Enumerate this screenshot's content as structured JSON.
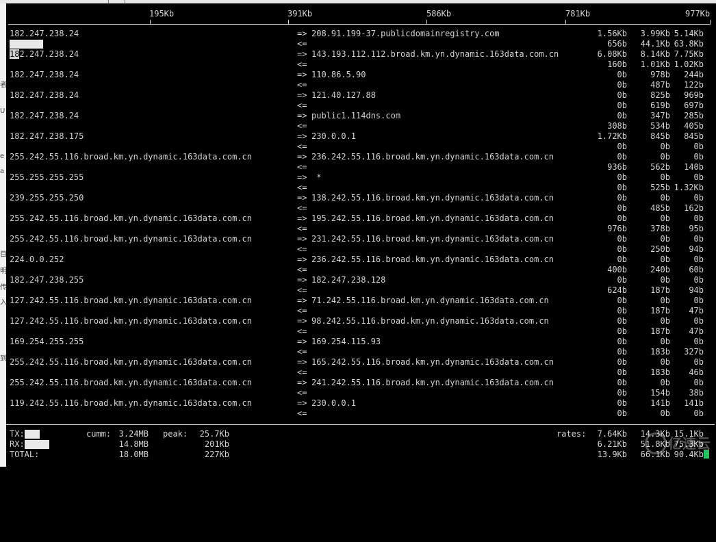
{
  "scale": {
    "labels": [
      "195Kb",
      "391Kb",
      "586Kb",
      "781Kb",
      "977Kb"
    ]
  },
  "connections": [
    {
      "src": "182.247.238.24",
      "dst": "208.91.199-37.publicdomainregistry.com",
      "out": [
        "1.56Kb",
        "3.99Kb",
        "5.14Kb"
      ],
      "in": [
        "656b",
        "44.1Kb",
        "63.8Kb"
      ]
    },
    {
      "src": "182.247.238.24",
      "dst": "143.193.112.112.broad.km.yn.dynamic.163data.com.cn",
      "out": [
        "6.08Kb",
        "8.14Kb",
        "7.75Kb"
      ],
      "in": [
        "160b",
        "1.01Kb",
        "1.02Kb"
      ]
    },
    {
      "src": "182.247.238.24",
      "dst": "110.86.5.90",
      "out": [
        "0b",
        "978b",
        "244b"
      ],
      "in": [
        "0b",
        "487b",
        "122b"
      ]
    },
    {
      "src": "182.247.238.24",
      "dst": "121.40.127.88",
      "out": [
        "0b",
        "825b",
        "969b"
      ],
      "in": [
        "0b",
        "619b",
        "697b"
      ]
    },
    {
      "src": "182.247.238.24",
      "dst": "public1.114dns.com",
      "out": [
        "0b",
        "347b",
        "285b"
      ],
      "in": [
        "308b",
        "534b",
        "405b"
      ]
    },
    {
      "src": "182.247.238.175",
      "dst": "230.0.0.1",
      "out": [
        "1.72Kb",
        "845b",
        "845b"
      ],
      "in": [
        "0b",
        "0b",
        "0b"
      ]
    },
    {
      "src": "255.242.55.116.broad.km.yn.dynamic.163data.com.cn",
      "dst": "236.242.55.116.broad.km.yn.dynamic.163data.com.cn",
      "out": [
        "0b",
        "0b",
        "0b"
      ],
      "in": [
        "936b",
        "562b",
        "140b"
      ]
    },
    {
      "src": "255.255.255.255",
      "dst": " *",
      "out": [
        "0b",
        "0b",
        "0b"
      ],
      "in": [
        "0b",
        "525b",
        "1.32Kb"
      ]
    },
    {
      "src": "239.255.255.250",
      "dst": "138.242.55.116.broad.km.yn.dynamic.163data.com.cn",
      "out": [
        "0b",
        "0b",
        "0b"
      ],
      "in": [
        "0b",
        "485b",
        "162b"
      ]
    },
    {
      "src": "255.242.55.116.broad.km.yn.dynamic.163data.com.cn",
      "dst": "195.242.55.116.broad.km.yn.dynamic.163data.com.cn",
      "out": [
        "0b",
        "0b",
        "0b"
      ],
      "in": [
        "976b",
        "378b",
        "95b"
      ]
    },
    {
      "src": "255.242.55.116.broad.km.yn.dynamic.163data.com.cn",
      "dst": "231.242.55.116.broad.km.yn.dynamic.163data.com.cn",
      "out": [
        "0b",
        "0b",
        "0b"
      ],
      "in": [
        "0b",
        "250b",
        "94b"
      ]
    },
    {
      "src": "224.0.0.252",
      "dst": "236.242.55.116.broad.km.yn.dynamic.163data.com.cn",
      "out": [
        "0b",
        "0b",
        "0b"
      ],
      "in": [
        "400b",
        "240b",
        "60b"
      ]
    },
    {
      "src": "182.247.238.255",
      "dst": "182.247.238.128",
      "out": [
        "0b",
        "0b",
        "0b"
      ],
      "in": [
        "624b",
        "187b",
        "94b"
      ]
    },
    {
      "src": "127.242.55.116.broad.km.yn.dynamic.163data.com.cn",
      "dst": "71.242.55.116.broad.km.yn.dynamic.163data.com.cn",
      "out": [
        "0b",
        "0b",
        "0b"
      ],
      "in": [
        "0b",
        "187b",
        "47b"
      ]
    },
    {
      "src": "127.242.55.116.broad.km.yn.dynamic.163data.com.cn",
      "dst": "98.242.55.116.broad.km.yn.dynamic.163data.com.cn",
      "out": [
        "0b",
        "0b",
        "0b"
      ],
      "in": [
        "0b",
        "187b",
        "47b"
      ]
    },
    {
      "src": "169.254.255.255",
      "dst": "169.254.115.93",
      "out": [
        "0b",
        "0b",
        "0b"
      ],
      "in": [
        "0b",
        "183b",
        "327b"
      ]
    },
    {
      "src": "255.242.55.116.broad.km.yn.dynamic.163data.com.cn",
      "dst": "165.242.55.116.broad.km.yn.dynamic.163data.com.cn",
      "out": [
        "0b",
        "0b",
        "0b"
      ],
      "in": [
        "0b",
        "183b",
        "46b"
      ]
    },
    {
      "src": "255.242.55.116.broad.km.yn.dynamic.163data.com.cn",
      "dst": "241.242.55.116.broad.km.yn.dynamic.163data.com.cn",
      "out": [
        "0b",
        "0b",
        "0b"
      ],
      "in": [
        "0b",
        "154b",
        "38b"
      ]
    },
    {
      "src": "119.242.55.116.broad.km.yn.dynamic.163data.com.cn",
      "dst": "230.0.0.1",
      "out": [
        "0b",
        "141b",
        "141b"
      ],
      "in": [
        "0b",
        "0b",
        "0b"
      ]
    }
  ],
  "arrows": {
    "out": "=>",
    "in": "<="
  },
  "footer": {
    "tx": {
      "label": "TX:",
      "cumm_label": "cumm:",
      "cumm": "3.24MB",
      "peak_label": "peak:",
      "peak": "25.7Kb",
      "rates_label": "rates:",
      "rates": [
        "7.64Kb",
        "14.3Kb",
        "15.1Kb"
      ]
    },
    "rx": {
      "label": "RX:",
      "cumm": "14.8MB",
      "peak": "201Kb",
      "rates": [
        "6.21Kb",
        "51.8Kb",
        "75.3Kb"
      ]
    },
    "total": {
      "label": "TOTAL:",
      "cumm": "18.0MB",
      "peak": "227Kb",
      "rates": [
        "13.9Kb",
        "66.1Kb",
        "90.4Kb"
      ]
    }
  },
  "watermark": "亿速云",
  "edge_text": [
    "者",
    "U",
    "e",
    "a",
    "目",
    "明",
    "传",
    "入",
    "到"
  ],
  "colors": {
    "background": "#000000",
    "text": "#d4d4d4",
    "cursor": "#22c55e"
  }
}
